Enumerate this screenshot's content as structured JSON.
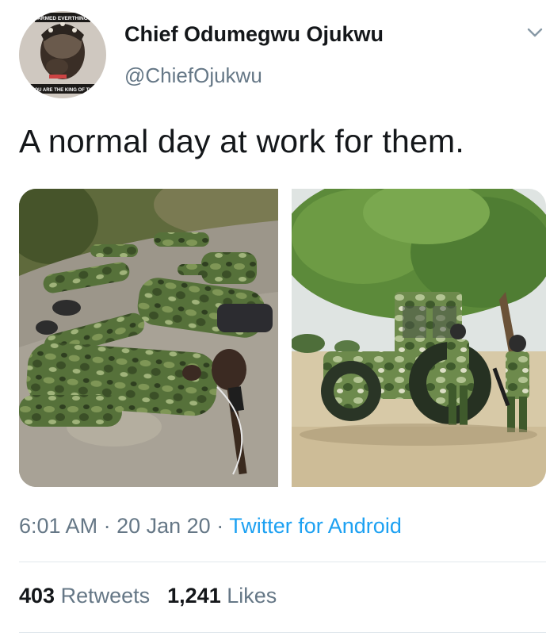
{
  "author": {
    "display_name": "Chief Odumegwu Ojukwu",
    "handle": "@ChiefOjukwu",
    "avatar_icon": "profile-photo",
    "avatar_banner_top": "ARMED EVERTHING",
    "avatar_banner_bottom": "YOU ARE THE KING OF THE"
  },
  "tweet": {
    "text": "A normal day at work for them.",
    "media": [
      {
        "icon": "photo-soldiers-resting-on-rock"
      },
      {
        "icon": "photo-camouflage-tractor-soldiers"
      }
    ]
  },
  "meta": {
    "time": "6:01 AM",
    "separator": "·",
    "date": "20 Jan 20",
    "source": "Twitter for Android"
  },
  "stats": {
    "retweets_count": "403",
    "retweets_label": "Retweets",
    "likes_count": "1,241",
    "likes_label": "Likes"
  },
  "colors": {
    "text": "#14171a",
    "secondary": "#657786",
    "link": "#1da1f2",
    "divider": "#e1e8ed",
    "camo_green": "#4f6b34",
    "camo_light": "#8fa46a"
  }
}
